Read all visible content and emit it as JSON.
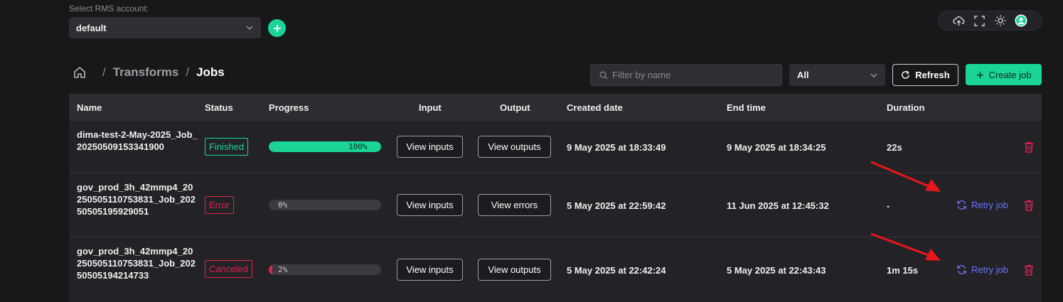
{
  "account": {
    "label": "Select RMS account:",
    "selected": "default"
  },
  "top_tools": {
    "icons": [
      "upload-cloud-icon",
      "fullscreen-icon",
      "theme-sun-icon",
      "user-avatar-icon"
    ]
  },
  "breadcrumb": {
    "items": [
      "Transforms",
      "Jobs"
    ],
    "separator": "/"
  },
  "toolbar": {
    "filter_placeholder": "Filter by name",
    "status_filter": "All",
    "refresh_label": "Refresh",
    "create_label": "Create job"
  },
  "table": {
    "headers": {
      "name": "Name",
      "status": "Status",
      "progress": "Progress",
      "input": "Input",
      "output": "Output",
      "created": "Created date",
      "end": "End time",
      "duration": "Duration"
    },
    "rows": [
      {
        "name": "dima-test-2-May-2025_Job_20250509153341900",
        "status": "Finished",
        "progress": 100,
        "progress_label": "100%",
        "input_btn": "View inputs",
        "output_btn": "View outputs",
        "created": "9 May 2025 at 18:33:49",
        "end": "9 May 2025 at 18:34:25",
        "duration": "22s",
        "retry": ""
      },
      {
        "name": "gov_prod_3h_42mmp4_20250505110753831_Job_20250505195929051",
        "status": "Error",
        "progress": 0,
        "progress_label": "0%",
        "input_btn": "View inputs",
        "output_btn": "View errors",
        "created": "5 May 2025 at 22:59:42",
        "end": "11 Jun 2025 at 12:45:32",
        "duration": "-",
        "retry": "Retry job"
      },
      {
        "name": "gov_prod_3h_42mmp4_20250505110753831_Job_20250505194214733",
        "status": "Canceled",
        "progress": 2,
        "progress_label": "2%",
        "input_btn": "View inputs",
        "output_btn": "View outputs",
        "created": "5 May 2025 at 22:42:24",
        "end": "5 May 2025 at 22:43:43",
        "duration": "1m 15s",
        "retry": "Retry job"
      }
    ]
  },
  "colors": {
    "accent": "#1ad597",
    "finished": "#1ad597",
    "error": "#e0204f",
    "retry": "#6a74f5",
    "annotation_arrow": "#e8161b"
  }
}
